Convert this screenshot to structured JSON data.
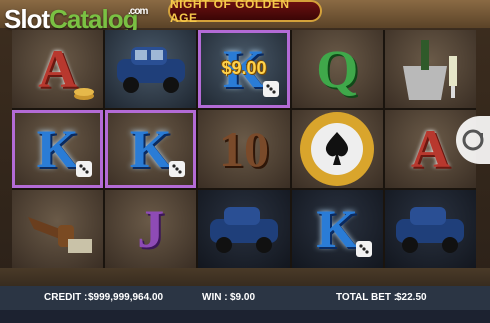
{
  "logo": {
    "text_a": "Slot",
    "text_b": "Catalog",
    "text_c": ".com"
  },
  "title": "NIGHT OF GOLDEN AGE",
  "reels": [
    [
      "A",
      "car",
      "pipe"
    ],
    [
      "car",
      "K",
      "J"
    ],
    [
      "K",
      "10",
      "car"
    ],
    [
      "Q",
      "chip",
      "K"
    ],
    [
      "champagne",
      "A",
      "car"
    ]
  ],
  "win_overlay": "$9.00",
  "status": {
    "credit_label": "CREDIT :",
    "credit_value": "$999,999,964.00",
    "win_label": "WIN :",
    "win_value": "$9.00",
    "total_bet_label": "TOTAL BET :",
    "total_bet_value": "$22.50"
  },
  "colors": {
    "win_highlight": "#b36bd6",
    "title_gold": "#f5c84a",
    "status_bg": "#2b3544"
  }
}
